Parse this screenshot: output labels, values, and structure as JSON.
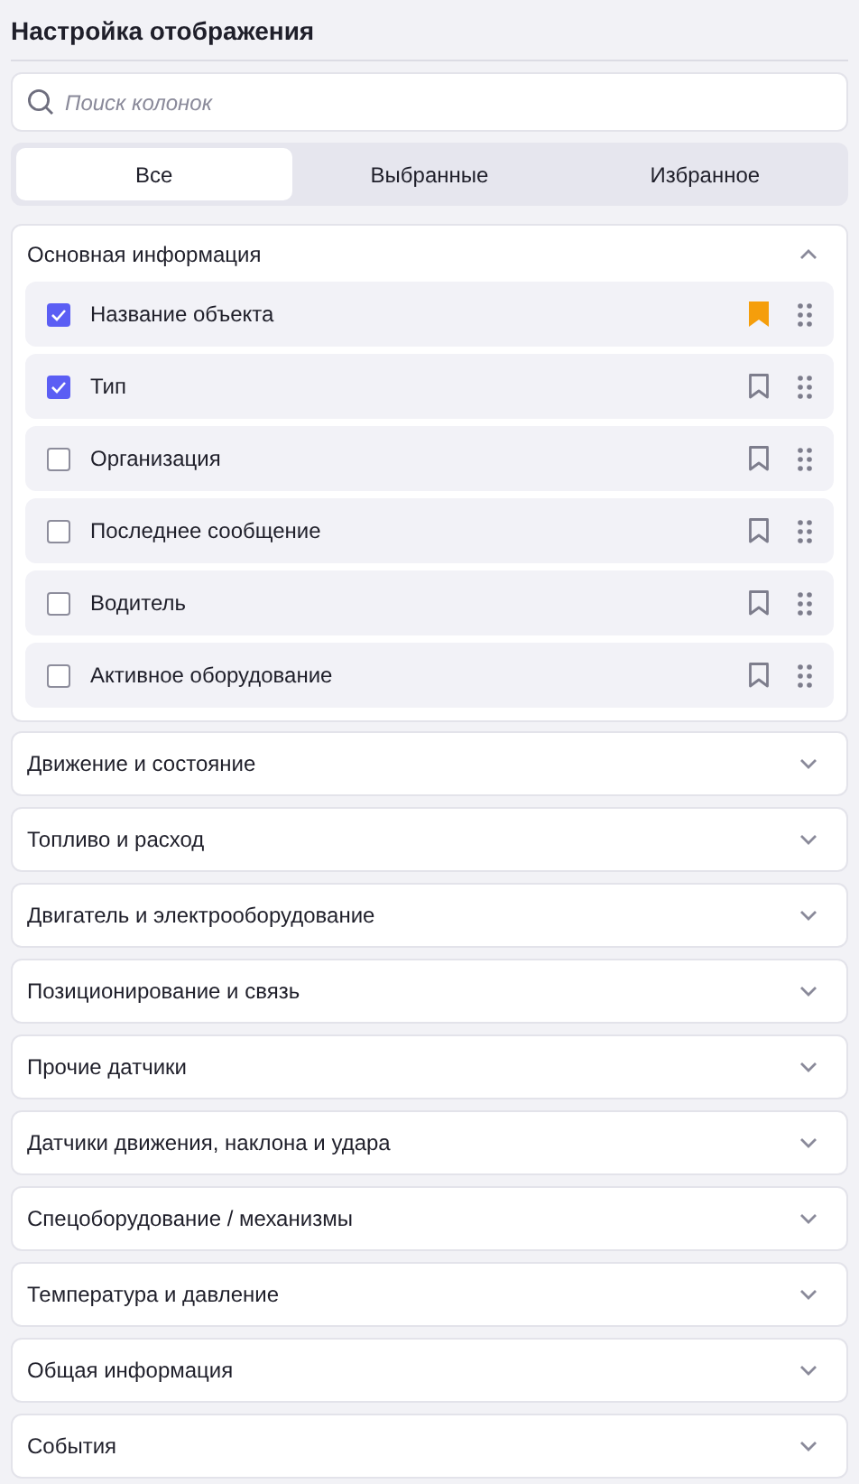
{
  "title": "Настройка отображения",
  "search": {
    "placeholder": "Поиск колонок"
  },
  "tabs": [
    {
      "label": "Все",
      "selected": true
    },
    {
      "label": "Выбранные",
      "selected": false
    },
    {
      "label": "Избранное",
      "selected": false
    }
  ],
  "sections": [
    {
      "title": "Основная информация",
      "expanded": true,
      "items": [
        {
          "label": "Название объекта",
          "checked": true,
          "favorite": true
        },
        {
          "label": "Тип",
          "checked": true,
          "favorite": false
        },
        {
          "label": "Организация",
          "checked": false,
          "favorite": false
        },
        {
          "label": "Последнее сообщение",
          "checked": false,
          "favorite": false
        },
        {
          "label": "Водитель",
          "checked": false,
          "favorite": false
        },
        {
          "label": "Активное оборудование",
          "checked": false,
          "favorite": false
        }
      ]
    },
    {
      "title": "Движение и состояние",
      "expanded": false
    },
    {
      "title": "Топливо и расход",
      "expanded": false
    },
    {
      "title": "Двигатель и электрооборудование",
      "expanded": false
    },
    {
      "title": "Позиционирование и связь",
      "expanded": false
    },
    {
      "title": "Прочие датчики",
      "expanded": false
    },
    {
      "title": "Датчики движения, наклона и удара",
      "expanded": false
    },
    {
      "title": "Спецоборудование / механизмы",
      "expanded": false
    },
    {
      "title": "Температура и давление",
      "expanded": false
    },
    {
      "title": "Общая информация",
      "expanded": false
    },
    {
      "title": "События",
      "expanded": false
    }
  ]
}
